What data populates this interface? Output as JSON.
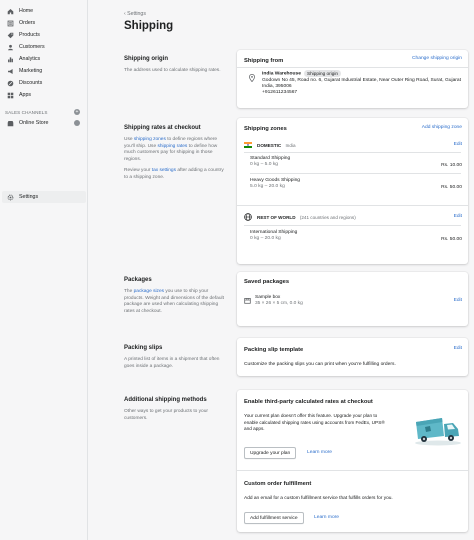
{
  "sidebar": {
    "items": [
      {
        "label": "Home",
        "icon": "home-icon"
      },
      {
        "label": "Orders",
        "icon": "orders-icon"
      },
      {
        "label": "Products",
        "icon": "products-icon"
      },
      {
        "label": "Customers",
        "icon": "customers-icon"
      },
      {
        "label": "Analytics",
        "icon": "analytics-icon"
      },
      {
        "label": "Marketing",
        "icon": "marketing-icon"
      },
      {
        "label": "Discounts",
        "icon": "discounts-icon"
      },
      {
        "label": "Apps",
        "icon": "apps-icon"
      }
    ],
    "sales_channels_heading": "SALES CHANNELS",
    "online_store": "Online Store",
    "settings": "Settings"
  },
  "header": {
    "breadcrumb": "Settings",
    "title": "Shipping"
  },
  "origin": {
    "heading": "Shipping origin",
    "desc": "The address used to calculate shipping rates.",
    "card_title": "Shipping from",
    "action": "Change shipping origin",
    "location_name": "India Warehouse",
    "badge": "Shipping origin",
    "address_line1": "Godown No 45, Road no. 6, Gujarat Industrial Estate, Near Outer Ring Road, Surat, Gujarat",
    "address_line2": "India, 395006",
    "phone": "+912611234567"
  },
  "rates": {
    "heading": "Shipping rates at checkout",
    "desc1_a": "Use ",
    "desc1_link1": "shipping zones",
    "desc1_b": " to define regions where you'll ship. Use ",
    "desc1_link2": "shipping rates",
    "desc1_c": " to define how much customers pay for shipping in those regions.",
    "desc2_a": "Review your ",
    "desc2_link": "tax settings",
    "desc2_b": " after adding a country to a shipping zone.",
    "card_title": "Shipping zones",
    "action": "Add shipping zone",
    "domestic": {
      "label": "DOMESTIC",
      "country": "India",
      "edit": "Edit",
      "rates": [
        {
          "name": "Standard Shipping",
          "range": "0 kg – 5.0 kg",
          "price": "Rs. 10.00"
        },
        {
          "name": "Heavy Goods Shipping",
          "range": "5.0 kg – 20.0 kg",
          "price": "Rs. 50.00"
        }
      ]
    },
    "world": {
      "label": "REST OF WORLD",
      "detail": "(241 countries and regions)",
      "edit": "Edit",
      "rates": [
        {
          "name": "International Shipping",
          "range": "0 kg – 20.0 kg",
          "price": "Rs. 50.00"
        }
      ]
    }
  },
  "packages": {
    "heading": "Packages",
    "desc_a": "The ",
    "desc_link": "package sizes",
    "desc_b": " you use to ship your products. Weight and dimensions of the default package are used when calculating shipping rates at checkout.",
    "card_title": "Saved packages",
    "pkg_name": "Sample box",
    "pkg_dims": "35 × 26 × 5 cm, 0.0 kg",
    "edit": "Edit"
  },
  "slips": {
    "heading": "Packing slips",
    "desc": "A printed list of items in a shipment that often goes inside a package.",
    "card_title": "Packing slip template",
    "edit": "Edit",
    "card_desc": "Customize the packing slips you can print when you're fulfilling orders."
  },
  "additional": {
    "heading": "Additional shipping methods",
    "desc": "Other ways to get your products to your customers.",
    "third_party": {
      "title": "Enable third-party calculated rates at checkout",
      "text_line1": "Your current plan doesn't offer this feature. Upgrade your plan to",
      "text_line2": "enable calculated shipping rates using accounts from FedEx, UPS®",
      "text_line3": "and apps.",
      "upgrade": "Upgrade your plan",
      "learn": "Learn more"
    },
    "custom": {
      "title": "Custom order fulfillment",
      "text": "Add an email for a custom fulfillment service that fulfills orders for you.",
      "add": "Add fulfillment service",
      "learn": "Learn more"
    }
  },
  "colors": {
    "accent": "#2c6ecb",
    "truck": "#5fb8c8"
  }
}
